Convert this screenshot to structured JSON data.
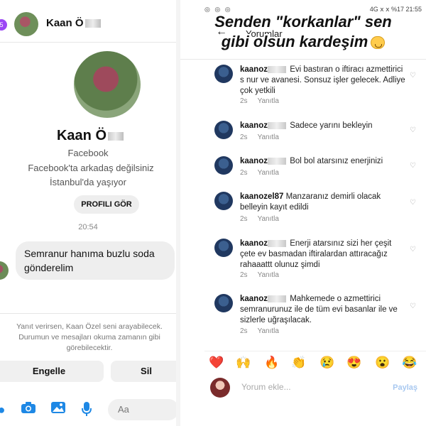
{
  "left": {
    "header": {
      "badge": "5",
      "name": "Kaan Ö"
    },
    "profile": {
      "name": "Kaan Ö",
      "source": "Facebook",
      "friend_status": "Facebook'ta arkadaş değilsiniz",
      "location": "İstanbul'da yaşıyor",
      "profile_button": "PROFILI GÖR"
    },
    "time": "20:54",
    "message": "Semranur hanıma buzlu soda gönderelim",
    "notice": "Yanıt verirsen, Kaan Özel seni arayabilecek. Durumun ve mesajları okuma zamanın gibi görebilecektir.",
    "buttons": {
      "block": "Engelle",
      "delete": "Sil"
    },
    "composer": {
      "placeholder": "Aa",
      "icons": [
        "plus-icon",
        "camera-icon",
        "photo-icon",
        "microphone-icon"
      ]
    }
  },
  "right": {
    "status": {
      "left": "◎ ◎ ◎",
      "right": "4G ⅹ ⅹ %17 21:55"
    },
    "caption_line1": "Senden \"korkanlar\" sen",
    "caption_line2": "gibi olsun kardeşim",
    "title": "Yorumlar",
    "comments": [
      {
        "user": "kaanoz",
        "text": "Evi bastıran o iftiracı azmettirici s nur ve avanesi. Sonsuz işler gelecek. Adliye çok yetkili",
        "time": "2s",
        "reply": "Yanıtla"
      },
      {
        "user": "kaanoz",
        "text": "Sadece yarını bekleyin",
        "time": "2s",
        "reply": "Yanıtla"
      },
      {
        "user": "kaanoz",
        "text": "Bol bol atarsınız enerjinizi",
        "time": "2s",
        "reply": "Yanıtla"
      },
      {
        "user": "kaanozel87",
        "text": "Manzaranız demirli olacak belleyin kayıt edildi",
        "time": "2s",
        "reply": "Yanıtla"
      },
      {
        "user": "kaanoz",
        "text": "Enerji atarsınız sizi her çeşit çete ev basmadan iftiralardan attıracağız rahaaattt olunuz şimdi",
        "time": "2s",
        "reply": "Yanıtla"
      },
      {
        "user": "kaanoz",
        "text": "Mahkemede o azmettirici semranurunuz ile de tüm evi basanlar ile ve sizlerle uğraşılacak.",
        "time": "2s",
        "reply": "Yanıtla"
      }
    ],
    "reactions": [
      "❤️",
      "🙌",
      "🔥",
      "👏",
      "😢",
      "😍",
      "😮",
      "😂"
    ],
    "add_comment": {
      "placeholder": "Yorum ekle...",
      "post": "Paylaş"
    }
  }
}
